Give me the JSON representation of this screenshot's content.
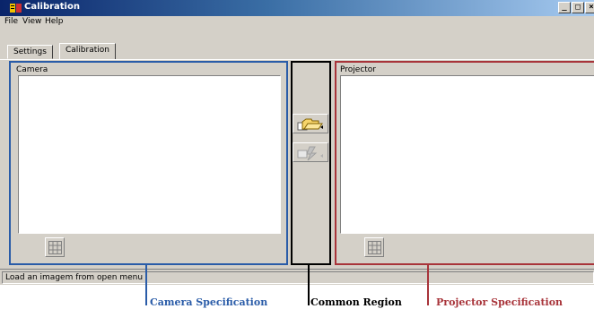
{
  "window": {
    "title": "Calibration"
  },
  "title_buttons": {
    "minimize": "_",
    "maximize": "□",
    "close": "×"
  },
  "menu": [
    "File",
    "View",
    "Help"
  ],
  "tabs": [
    {
      "label": "Settings",
      "active": false
    },
    {
      "label": "Calibration",
      "active": true
    }
  ],
  "camera": {
    "label": "Camera",
    "grid_icon": "grid-icon"
  },
  "projector": {
    "label": "Projector",
    "grid_icon": "grid-icon"
  },
  "common": {
    "tools": [
      "open-folder-icon",
      "capture-flash-icon"
    ]
  },
  "status": "Load an imagem from open menu",
  "annotations": {
    "camera": "Camera Specification",
    "common": "Common Region",
    "projector": "Projector Specification"
  },
  "colors": {
    "camera": "#2a5ca8",
    "common": "#000000",
    "projector": "#a8343a"
  }
}
